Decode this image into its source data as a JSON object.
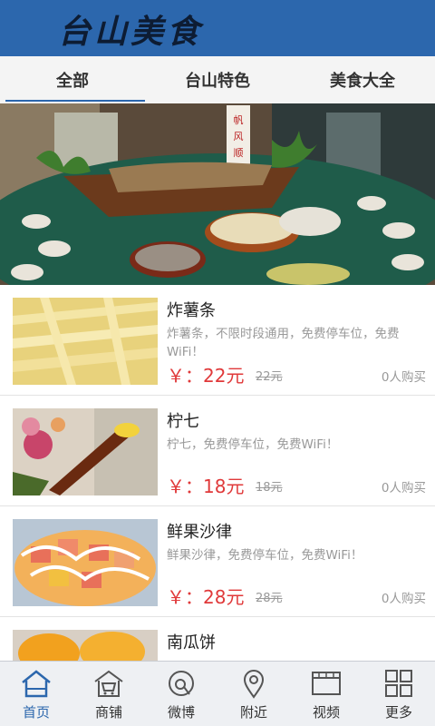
{
  "header": {
    "title": "台山美食"
  },
  "tabs": [
    {
      "label": "全部"
    },
    {
      "label": "台山特色"
    },
    {
      "label": "美食大全"
    }
  ],
  "banner": {
    "sign_text": "帆风顺"
  },
  "items": [
    {
      "name": "炸薯条",
      "desc": "炸薯条，不限时段通用，免费停车位，免费WiFi！",
      "price": "￥：22元",
      "old_price": "22元",
      "sold": "0人购买"
    },
    {
      "name": "柠七",
      "desc": "柠七，免费停车位，免费WiFi！",
      "price": "￥：18元",
      "old_price": "18元",
      "sold": "0人购买"
    },
    {
      "name": "鲜果沙律",
      "desc": "鲜果沙律，免费停车位，免费WiFi！",
      "price": "￥：28元",
      "old_price": "28元",
      "sold": "0人购买"
    },
    {
      "name": "南瓜饼",
      "desc": "",
      "price": "",
      "old_price": "",
      "sold": ""
    }
  ],
  "nav": [
    {
      "label": "首页",
      "icon": "home-icon"
    },
    {
      "label": "商铺",
      "icon": "shop-icon"
    },
    {
      "label": "微博",
      "icon": "weibo-icon"
    },
    {
      "label": "附近",
      "icon": "location-icon"
    },
    {
      "label": "视频",
      "icon": "video-icon"
    },
    {
      "label": "更多",
      "icon": "grid-icon"
    }
  ],
  "colors": {
    "header": "#2c67ad",
    "price": "#e0393a",
    "active_nav": "#2c67ad"
  }
}
